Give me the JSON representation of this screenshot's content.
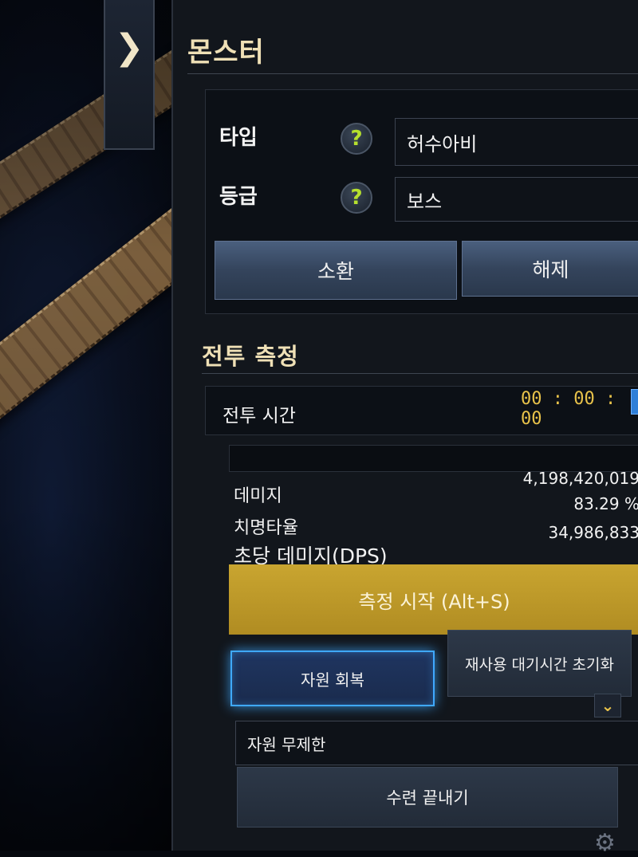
{
  "monster": {
    "title": "몬스터",
    "type_label": "타입",
    "type_value": "허수아비",
    "grade_label": "등급",
    "grade_value": "보스",
    "help_glyph": "?",
    "summon_label": "소환",
    "release_label": "해제"
  },
  "combat": {
    "title": "전투 측정",
    "time_label": "전투 시간",
    "time_value": "00 : 00 : 00",
    "damage_label": "데미지",
    "damage_value": "4,198,420,019",
    "crit_label": "치명타율",
    "crit_value": "83.29 %",
    "dps_label": "초당 데미지(DPS)",
    "dps_value": "34,986,833",
    "start_label": "측정 시작 (Alt+S)"
  },
  "resources": {
    "recover_label": "자원 회복",
    "cooldown_reset_label": "재사용 대기시간 초기화",
    "dropdown_value": "자원 무제한",
    "end_training_label": "수련 끝내기"
  },
  "icons": {
    "collapse": "chevron-right-icon",
    "help": "help-icon",
    "dropdown": "chevron-down-icon",
    "settings": "gear-icon"
  },
  "colors": {
    "title_gold": "#efe0b6",
    "help_green": "#b6e02e",
    "time_yellow": "#e8c24a",
    "start_button_gold": "#b08c22",
    "active_glow_blue": "#3fa9ff"
  }
}
